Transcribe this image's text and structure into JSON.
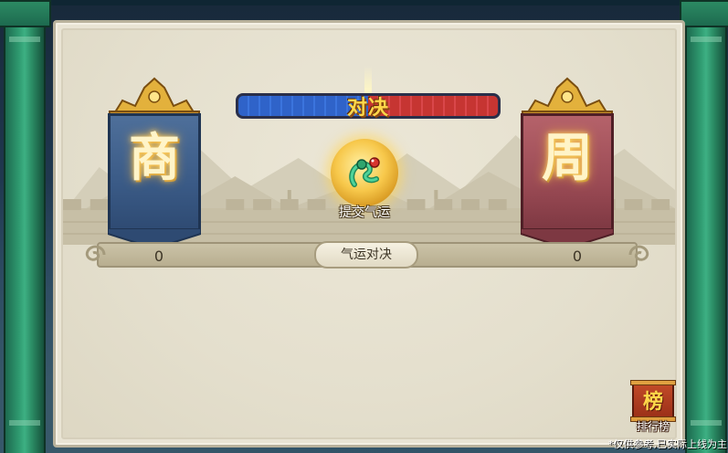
{
  "factions": {
    "left": {
      "glyph": "商",
      "score": "0",
      "color": "#3a5a86"
    },
    "right": {
      "glyph": "周",
      "score": "0",
      "color": "#9a4a54"
    }
  },
  "duel_bar": {
    "label": "对决",
    "blue_share": 0.5,
    "red_share": 0.5
  },
  "submit": {
    "label": "提交气运",
    "icon": "dragon-icon"
  },
  "duel_button": {
    "label": "气运对决"
  },
  "ranking": {
    "glyph": "榜",
    "label": "排行榜"
  },
  "disclaimer": "*仅供参考,已实际上线为主",
  "colors": {
    "pillar": "#2f9a70",
    "panel": "#e9e4d4",
    "gold": "#f7c84b",
    "blue": "#2f63c9",
    "red": "#c63532"
  }
}
